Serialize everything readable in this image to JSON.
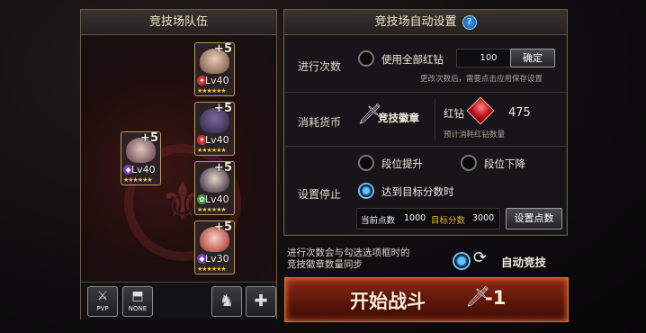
{
  "left_panel": {
    "title": "竞技场队伍",
    "heroes": [
      {
        "plus": "+5",
        "level": "Lv40",
        "stars": "★★★★★★",
        "color": "#d8b79a",
        "element": "fire"
      },
      {
        "plus": "+5",
        "level": "Lv40",
        "stars": "★★★★★★",
        "color": "#5a4a7a",
        "element": "fire"
      },
      {
        "plus": "+5",
        "level": "Lv40",
        "stars": "★★★★★★",
        "color": "#2b2746",
        "element": "wind"
      },
      {
        "plus": "+5",
        "level": "Lv30",
        "stars": "★★★★★★",
        "color": "#c83a30",
        "element": "dark"
      },
      {
        "plus": "+5",
        "level": "Lv40",
        "stars": "★★★★★★",
        "color": "#c4a3a0",
        "element": "dark"
      }
    ],
    "toolbar": {
      "pvp_label": "PVP",
      "none_label": "NONE"
    }
  },
  "right_panel": {
    "title": "竞技场自动设置",
    "help_label": "?",
    "count": {
      "label": "进行次数",
      "option": "使用全部红钻",
      "value": "100",
      "confirm": "确定",
      "note": "更改次数后，需要点击应用保存设置"
    },
    "currency": {
      "label": "消耗货币",
      "item": "竞技徽章",
      "gem_label": "红钻",
      "gem_value": "475",
      "note": "预计消耗红钻数量"
    },
    "stop": {
      "label": "设置停止",
      "opt_up": "段位提升",
      "opt_down": "段位下降",
      "opt_target": "达到目标分数时",
      "current_label": "当前点数",
      "current_value": "1000",
      "target_label": "目标分数",
      "target_value": "3000",
      "set_button": "设置点数"
    }
  },
  "footer": {
    "note_line1": "进行次数会与勾选选项框时的",
    "note_line2": "竞技徽章数量同步",
    "auto_label": "自动竞技",
    "start_label": "开始战斗",
    "cost": "-1"
  },
  "colors": {
    "accent": "#5ec4ff",
    "gold": "#f2c33a",
    "start_bg": "#8a2a17"
  }
}
